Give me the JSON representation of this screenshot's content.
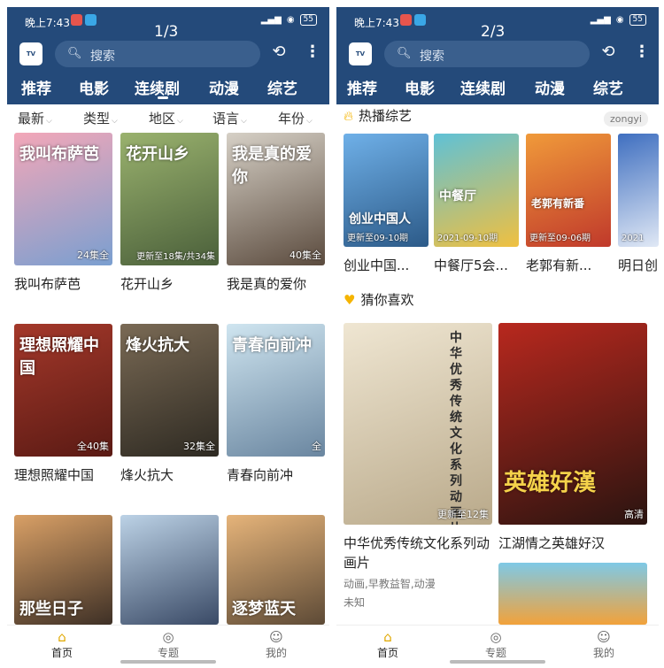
{
  "status": {
    "time": "晚上7:43",
    "battery": "55",
    "signal": "4G"
  },
  "search": {
    "placeholder": "搜索"
  },
  "tabs": [
    "推荐",
    "电影",
    "连续剧",
    "动漫",
    "综艺"
  ],
  "phone1": {
    "pager": "1/3",
    "filters": [
      "最新",
      "类型",
      "地区",
      "语言",
      "年份"
    ],
    "items": [
      {
        "title": "我叫布萨芭",
        "badge": "24集全",
        "poster_text": "我叫布萨芭",
        "color1": "#f3a7b8",
        "color2": "#7a9fd0"
      },
      {
        "title": "花开山乡",
        "badge": "更新至18集/共34集",
        "poster_text": "花开山乡",
        "color1": "#9ab26e",
        "color2": "#4a5f3a"
      },
      {
        "title": "我是真的爱你",
        "badge": "40集全",
        "poster_text": "我是真的爱你",
        "color1": "#d6d0c6",
        "color2": "#5b4b3e"
      },
      {
        "title": "理想照耀中国",
        "badge": "全40集",
        "poster_text": "理想照耀中国",
        "color1": "#a4382a",
        "color2": "#5a1a14"
      },
      {
        "title": "烽火抗大",
        "badge": "32集全",
        "poster_text": "烽火抗大",
        "color1": "#7a6a55",
        "color2": "#2e2a22"
      },
      {
        "title": "青春向前冲",
        "badge": "全",
        "poster_text": "青春向前冲",
        "color1": "#cfe5f0",
        "color2": "#6a86a0"
      },
      {
        "title": "",
        "badge": "",
        "poster_text": "那些日子",
        "color1": "#d9a066",
        "color2": "#3e3026"
      },
      {
        "title": "",
        "badge": "",
        "poster_text": "",
        "color1": "#bcd2e6",
        "color2": "#3a4a66"
      },
      {
        "title": "",
        "badge": "",
        "poster_text": "逐梦蓝天",
        "color1": "#e6b47a",
        "color2": "#5d4a36"
      }
    ]
  },
  "phone2": {
    "pager": "2/3",
    "section1": {
      "title": "热播综艺",
      "tag": "zongyi"
    },
    "hot": [
      {
        "title": "创业中国...",
        "badge": "更新至09-10期",
        "poster_text": "创业中国人",
        "color1": "#6fb0e8",
        "color2": "#2c5a88"
      },
      {
        "title": "中餐厅5会...",
        "badge": "2021-09-10期",
        "poster_text": "中餐厅",
        "color1": "#5fc1d6",
        "color2": "#f0c040"
      },
      {
        "title": "老郭有新...",
        "badge": "更新至09-06期",
        "poster_text": "老郭有新番",
        "color1": "#f09a3a",
        "color2": "#c0392b"
      },
      {
        "title": "明日创",
        "badge": "2021",
        "poster_text": "",
        "color1": "#3f6fc0",
        "color2": "#e0e8f5"
      }
    ],
    "section2": {
      "title": "猜你喜欢"
    },
    "guess": [
      {
        "title": "中华优秀传统文化系列动画片",
        "badge": "更新至12集",
        "poster_text": "中华优秀传统文化系列动画片",
        "tags": "动画,早教益智,动漫",
        "region": "未知",
        "color1": "#efe6d2",
        "color2": "#b9a98a"
      },
      {
        "title": "江湖情之英雄好汉",
        "badge": "高清",
        "poster_text": "英雄好漢",
        "tags": "",
        "region": "",
        "color1": "#b8281e",
        "color2": "#2a1410"
      }
    ]
  },
  "nav": [
    "首页",
    "专题",
    "我的"
  ],
  "icons": {
    "search": "search-icon",
    "history": "history-icon",
    "more": "more-icon"
  }
}
